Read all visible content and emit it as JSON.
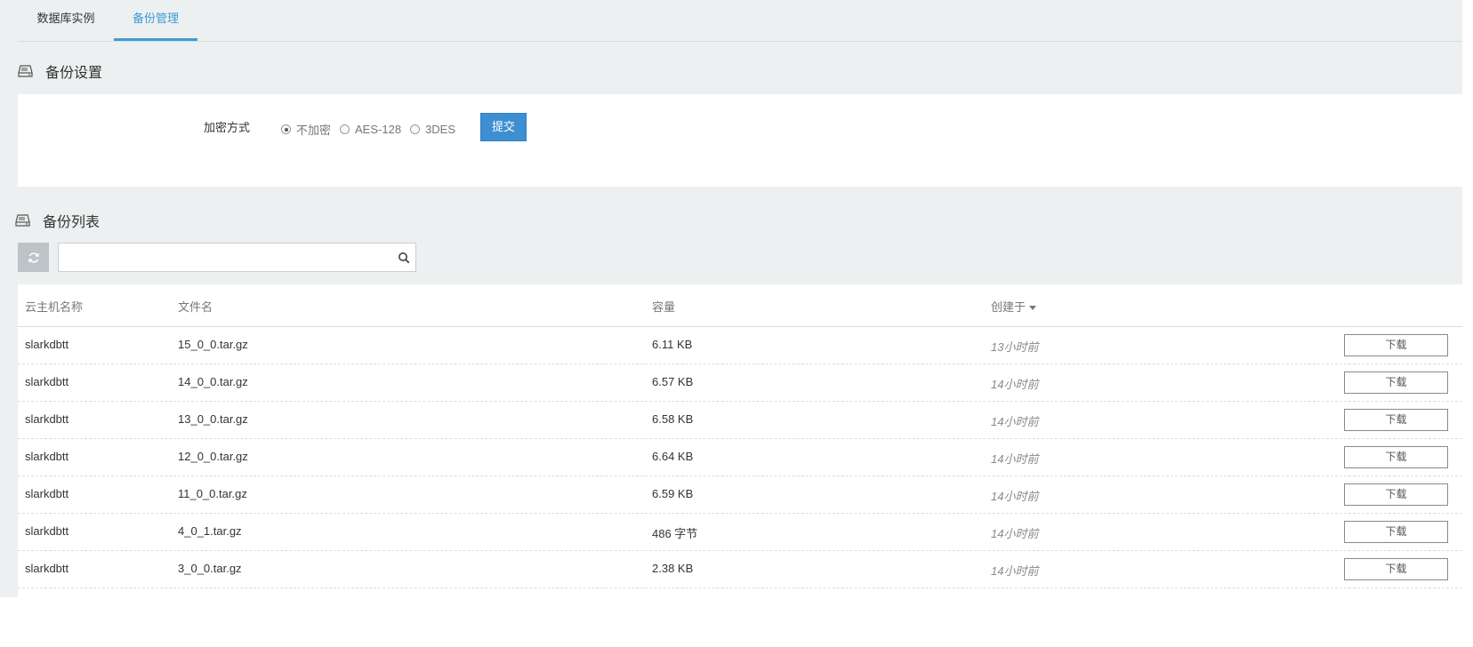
{
  "tabs": [
    {
      "label": "数据库实例",
      "active": false
    },
    {
      "label": "备份管理",
      "active": true
    }
  ],
  "settings": {
    "title": "备份设置",
    "encryption_label": "加密方式",
    "options": [
      {
        "label": "不加密",
        "checked": true
      },
      {
        "label": "AES-128",
        "checked": false
      },
      {
        "label": "3DES",
        "checked": false
      }
    ],
    "submit_label": "提交"
  },
  "backup_list": {
    "title": "备份列表",
    "search": {
      "value": "",
      "placeholder": ""
    },
    "columns": [
      "云主机名称",
      "文件名",
      "容量",
      "创建于"
    ],
    "sort_column": "创建于",
    "download_label": "下载",
    "rows": [
      {
        "host": "slarkdbtt",
        "file": "15_0_0.tar.gz",
        "size": "6.11 KB",
        "created": "13小时前"
      },
      {
        "host": "slarkdbtt",
        "file": "14_0_0.tar.gz",
        "size": "6.57 KB",
        "created": "14小时前"
      },
      {
        "host": "slarkdbtt",
        "file": "13_0_0.tar.gz",
        "size": "6.58 KB",
        "created": "14小时前"
      },
      {
        "host": "slarkdbtt",
        "file": "12_0_0.tar.gz",
        "size": "6.64 KB",
        "created": "14小时前"
      },
      {
        "host": "slarkdbtt",
        "file": "11_0_0.tar.gz",
        "size": "6.59 KB",
        "created": "14小时前"
      },
      {
        "host": "slarkdbtt",
        "file": "4_0_1.tar.gz",
        "size": "486 字节",
        "created": "14小时前"
      },
      {
        "host": "slarkdbtt",
        "file": "3_0_0.tar.gz",
        "size": "2.38 KB",
        "created": "14小时前"
      }
    ]
  },
  "colors": {
    "accent": "#3d9ad8",
    "button_primary": "#3d8fd1",
    "page_background": "#ecf0f1"
  }
}
